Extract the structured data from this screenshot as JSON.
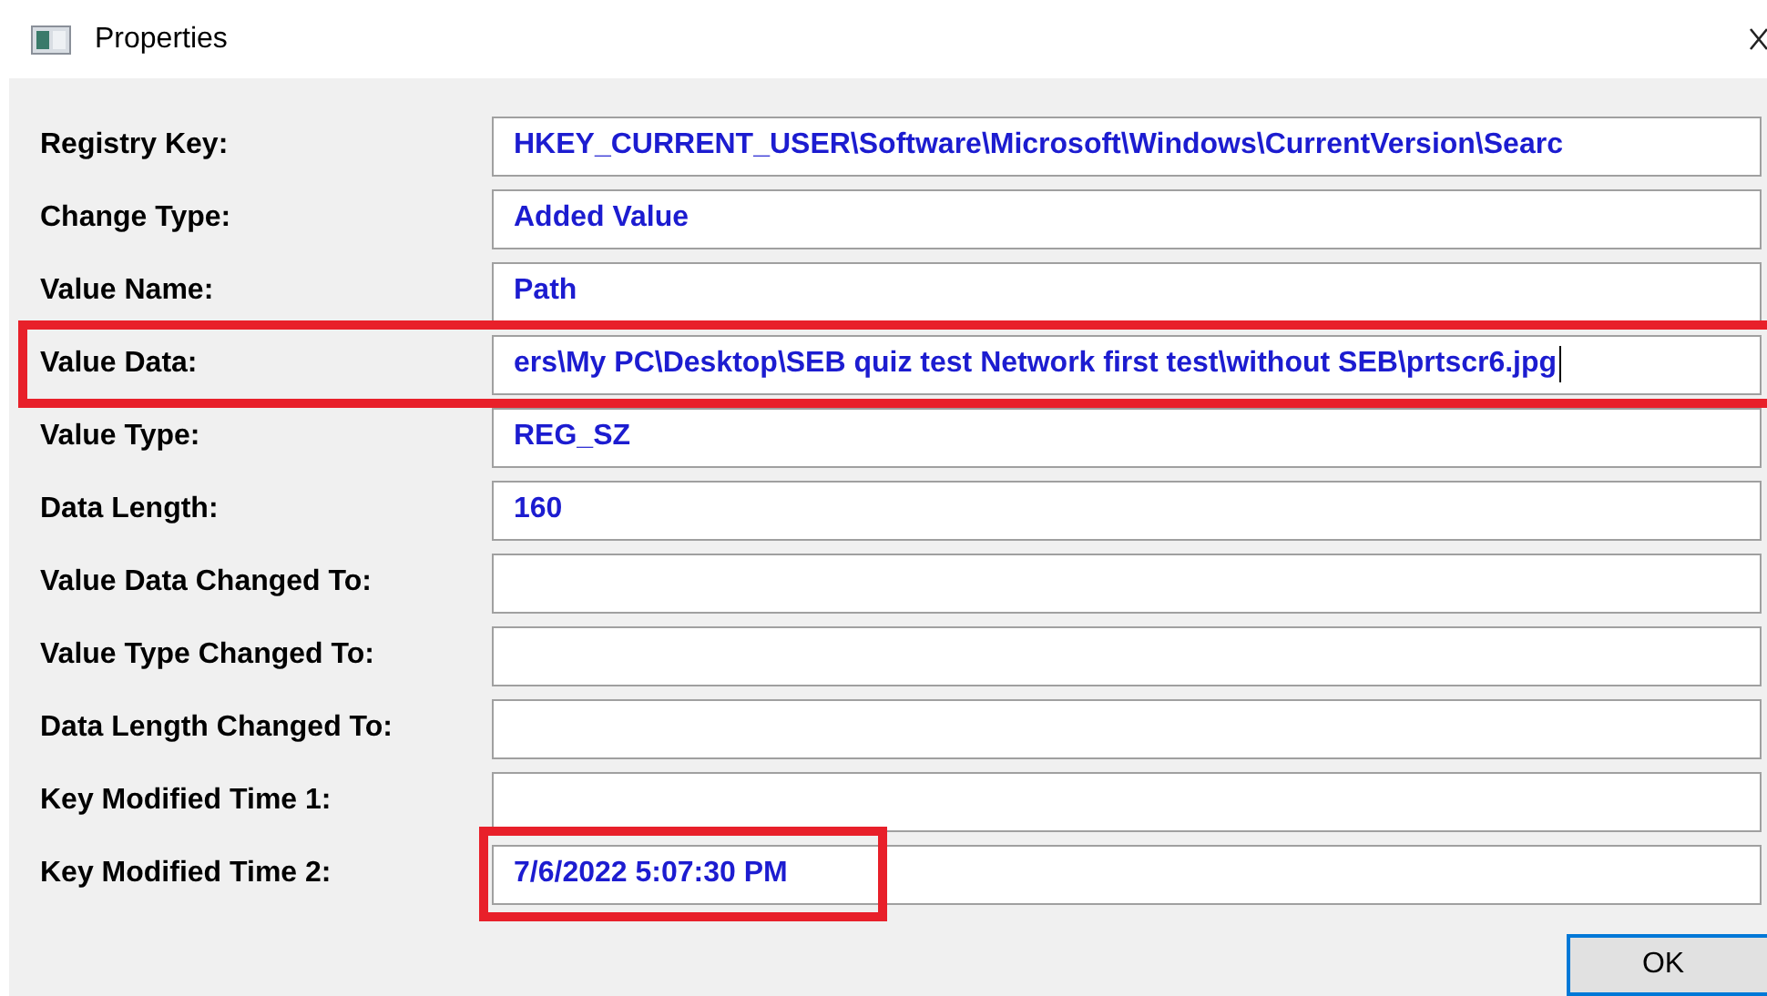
{
  "window": {
    "title": "Properties"
  },
  "rows": [
    {
      "label": "Registry Key:",
      "value": "HKEY_CURRENT_USER\\Software\\Microsoft\\Windows\\CurrentVersion\\Searc",
      "row_highlighted": false,
      "value_highlighted": false,
      "caret": false
    },
    {
      "label": "Change Type:",
      "value": "Added Value",
      "row_highlighted": false,
      "value_highlighted": false,
      "caret": false
    },
    {
      "label": "Value Name:",
      "value": "Path",
      "row_highlighted": false,
      "value_highlighted": false,
      "caret": false
    },
    {
      "label": "Value Data:",
      "value": "ers\\My PC\\Desktop\\SEB quiz test Network first test\\without SEB\\prtscr6.jpg",
      "row_highlighted": true,
      "value_highlighted": false,
      "caret": true
    },
    {
      "label": "Value Type:",
      "value": "REG_SZ",
      "row_highlighted": false,
      "value_highlighted": false,
      "caret": false
    },
    {
      "label": "Data Length:",
      "value": "160",
      "row_highlighted": false,
      "value_highlighted": false,
      "caret": false
    },
    {
      "label": "Value Data Changed To:",
      "row_highlighted": false,
      "value_highlighted": false,
      "caret": false
    },
    {
      "label": "Value Type Changed To:",
      "row_highlighted": false,
      "value_highlighted": false,
      "caret": false
    },
    {
      "label": "Data Length Changed To:",
      "row_highlighted": false,
      "value_highlighted": false,
      "caret": false
    },
    {
      "label": "Key Modified Time 1:",
      "row_highlighted": false,
      "value_highlighted": false,
      "caret": false
    },
    {
      "label": "Key Modified Time 2:",
      "value": "7/6/2022 5:07:30 PM",
      "row_highlighted": false,
      "value_highlighted": true,
      "caret": false
    }
  ],
  "buttons": [
    "OK"
  ]
}
